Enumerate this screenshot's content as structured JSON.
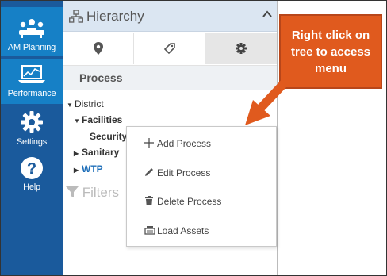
{
  "nav": {
    "cut_label": "Hierarchy",
    "items": [
      {
        "label": "AM Planning",
        "icon": "people-meeting-icon"
      },
      {
        "label": "Performance",
        "icon": "laptop-chart-icon"
      },
      {
        "label": "Settings",
        "icon": "gear-icon"
      },
      {
        "label": "Help",
        "icon": "question-icon"
      }
    ]
  },
  "panel": {
    "title": "Hierarchy",
    "section": "Process",
    "filters": "Filters"
  },
  "tree": {
    "district": "District",
    "facilities": "Facilities",
    "security": "Security",
    "sanitary": "Sanitary",
    "wtp": "WTP"
  },
  "context_menu": {
    "add": "Add Process",
    "edit": "Edit Process",
    "delete": "Delete Process",
    "load": "Load Assets"
  },
  "callout": {
    "text": "Right click on tree to access menu"
  },
  "colors": {
    "nav_bg": "#1a5a9c",
    "nav_active": "#1680c6",
    "callout": "#e05a1e",
    "link": "#1f6fb9"
  }
}
